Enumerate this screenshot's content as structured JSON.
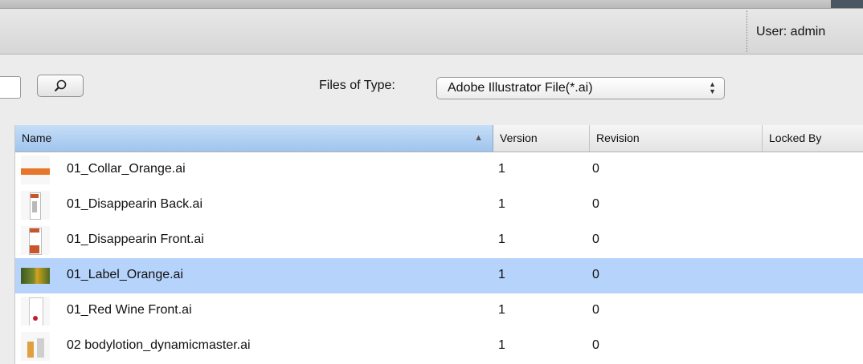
{
  "header": {
    "user_label": "User: admin"
  },
  "toolbar": {
    "search_value": "",
    "files_of_type_label": "Files of Type:",
    "file_type_selected": "Adobe Illustrator File(*.ai)"
  },
  "table": {
    "columns": {
      "name": "Name",
      "version": "Version",
      "revision": "Revision",
      "locked_by": "Locked By"
    },
    "sort_indicator": "▲",
    "rows": [
      {
        "name": "01_Collar_Orange.ai",
        "version": "1",
        "revision": "0",
        "locked_by": ""
      },
      {
        "name": "01_Disappearin Back.ai",
        "version": "1",
        "revision": "0",
        "locked_by": ""
      },
      {
        "name": "01_Disappearin Front.ai",
        "version": "1",
        "revision": "0",
        "locked_by": ""
      },
      {
        "name": "01_Label_Orange.ai",
        "version": "1",
        "revision": "0",
        "locked_by": ""
      },
      {
        "name": "01_Red Wine Front.ai",
        "version": "1",
        "revision": "0",
        "locked_by": ""
      },
      {
        "name": "02 bodylotion_dynamicmaster.ai",
        "version": "1",
        "revision": "0",
        "locked_by": ""
      }
    ]
  },
  "colors": {
    "selection": "#b5d3fb",
    "sorted_header": "#9fc4ee"
  },
  "icons": {
    "search": "magnifier-icon",
    "select": "updown-arrows-icon"
  }
}
